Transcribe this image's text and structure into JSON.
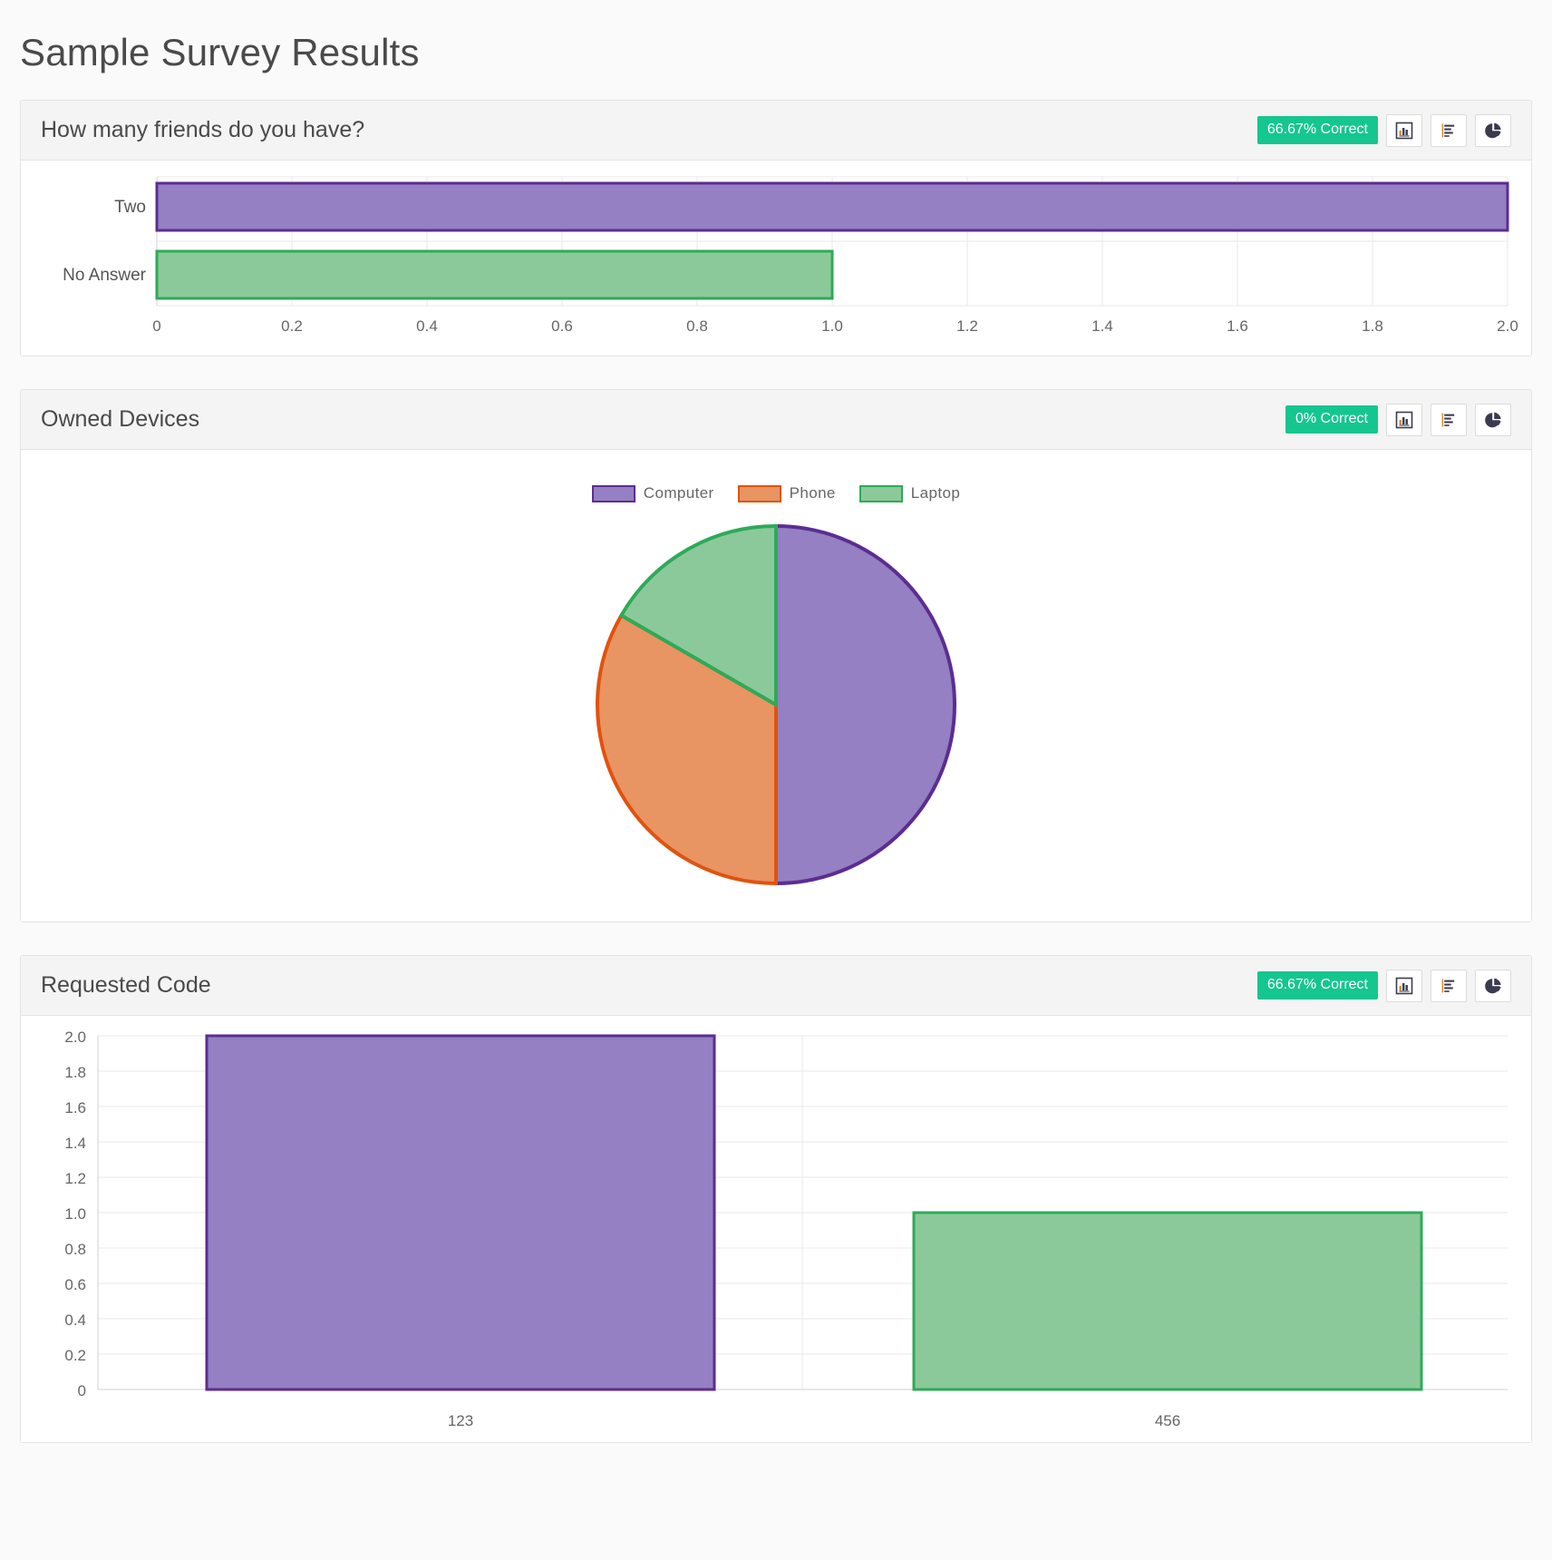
{
  "page": {
    "title": "Sample Survey Results"
  },
  "palette": {
    "purple_fill": "#9480c3",
    "purple_stroke": "#5b2d91",
    "green_fill": "#8cc99a",
    "green_stroke": "#2eaa58",
    "orange_fill": "#e89463",
    "orange_stroke": "#e2520d",
    "badge_green": "#15c68f",
    "grid": "#eaeaea",
    "axis": "#d0d0d0"
  },
  "icon_buttons": [
    {
      "name": "vertical-bar-chart-icon",
      "label": "Bar chart view"
    },
    {
      "name": "horizontal-bar-chart-icon",
      "label": "Horizontal bar chart view"
    },
    {
      "name": "pie-chart-icon",
      "label": "Pie chart view"
    }
  ],
  "cards": [
    {
      "id": "friends",
      "title": "How many friends do you have?",
      "badge": "66.67% Correct"
    },
    {
      "id": "devices",
      "title": "Owned Devices",
      "badge": "0% Correct"
    },
    {
      "id": "code",
      "title": "Requested Code",
      "badge": "66.67% Correct"
    }
  ],
  "chart_data": [
    {
      "id": "friends",
      "type": "bar",
      "orientation": "horizontal",
      "title": "How many friends do you have?",
      "categories": [
        "Two",
        "No Answer"
      ],
      "values": [
        2.0,
        1.0
      ],
      "colors": [
        "#9480c3",
        "#8cc99a"
      ],
      "stroke_colors": [
        "#5b2d91",
        "#2eaa58"
      ],
      "xlabel": "",
      "ylabel": "",
      "xlim": [
        0,
        2.0
      ],
      "xticks": [
        "0",
        "0.2",
        "0.4",
        "0.6",
        "0.8",
        "1.0",
        "1.2",
        "1.4",
        "1.6",
        "1.8",
        "2.0"
      ],
      "xtick_values": [
        0,
        0.2,
        0.4,
        0.6,
        0.8,
        1.0,
        1.2,
        1.4,
        1.6,
        1.8,
        2.0
      ],
      "grid": true,
      "legend": "none"
    },
    {
      "id": "devices",
      "type": "pie",
      "title": "Owned Devices",
      "labels": [
        "Computer",
        "Phone",
        "Laptop"
      ],
      "values": [
        3,
        2,
        1
      ],
      "percents": [
        50.0,
        33.33,
        16.67
      ],
      "colors": [
        "#9480c3",
        "#e89463",
        "#8cc99a"
      ],
      "stroke_colors": [
        "#5b2d91",
        "#e2520d",
        "#2eaa58"
      ],
      "legend": "top",
      "start_angle_deg": 0,
      "direction": "counterclockwise"
    },
    {
      "id": "code",
      "type": "bar",
      "orientation": "vertical",
      "title": "Requested Code",
      "categories": [
        "123",
        "456"
      ],
      "values": [
        2.0,
        1.0
      ],
      "colors": [
        "#9480c3",
        "#8cc99a"
      ],
      "stroke_colors": [
        "#5b2d91",
        "#2eaa58"
      ],
      "xlabel": "",
      "ylabel": "",
      "ylim": [
        0,
        2.0
      ],
      "yticks": [
        "0",
        "0.2",
        "0.4",
        "0.6",
        "0.8",
        "1.0",
        "1.2",
        "1.4",
        "1.6",
        "1.8",
        "2.0"
      ],
      "ytick_values": [
        0,
        0.2,
        0.4,
        0.6,
        0.8,
        1.0,
        1.2,
        1.4,
        1.6,
        1.8,
        2.0
      ],
      "grid": true,
      "legend": "none"
    }
  ]
}
